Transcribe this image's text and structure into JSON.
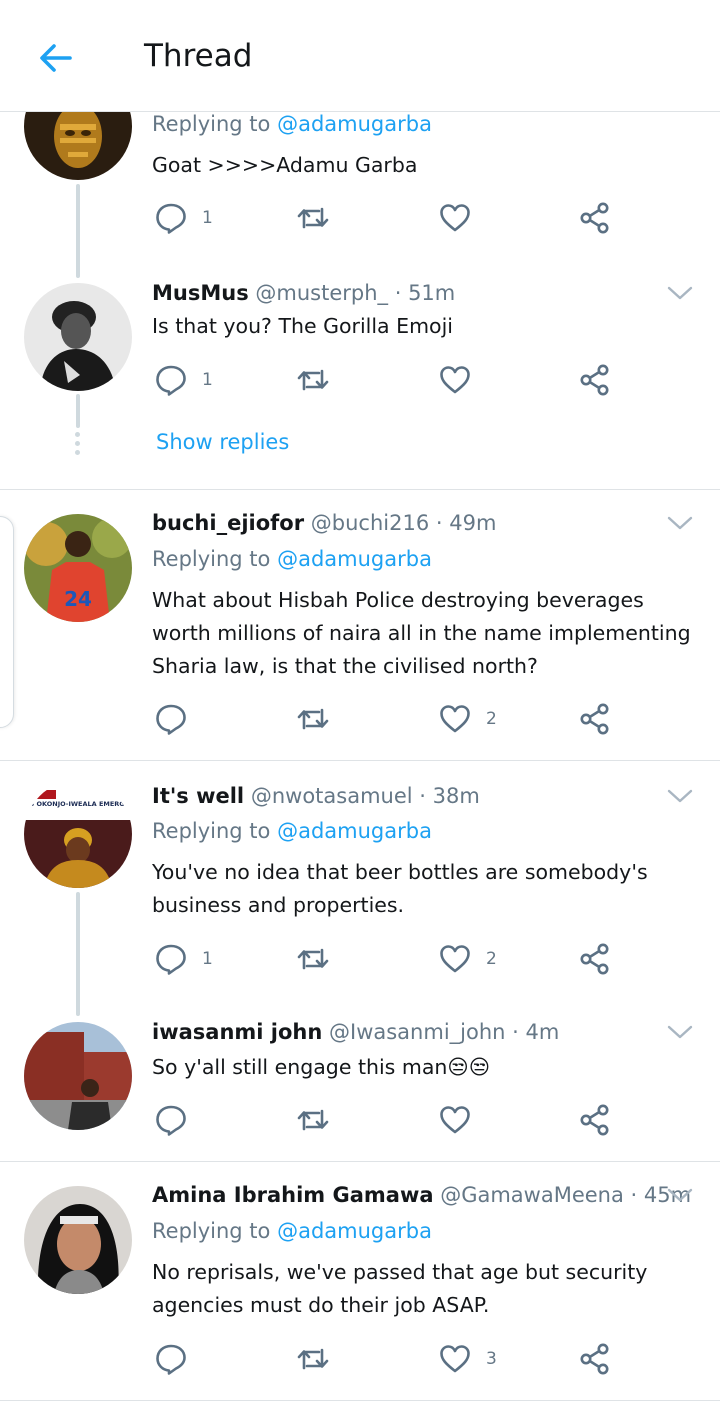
{
  "header": {
    "title": "Thread"
  },
  "tweets": [
    {
      "name": "",
      "handle": "",
      "time": "",
      "replying_label": "Replying to",
      "replying_handle": "@adamugarba",
      "text": "Goat >>>>Adamu Garba",
      "reply_count": "1",
      "retweet_count": "",
      "like_count": ""
    },
    {
      "name": "MusMus",
      "handle": "@musterph_",
      "time": "· 51m",
      "text": "Is that you? The Gorilla Emoji",
      "reply_count": "1",
      "retweet_count": "",
      "like_count": "",
      "show_replies": "Show replies"
    },
    {
      "name": "buchi_ejiofor",
      "handle": "@buchi216",
      "time": "· 49m",
      "replying_label": "Replying to",
      "replying_handle": "@adamugarba",
      "text": "What about Hisbah Police destroying beverages worth millions of naira all in the name implementing Sharia law, is that the civilised north?",
      "reply_count": "",
      "retweet_count": "",
      "like_count": "2"
    },
    {
      "name": "It's well",
      "handle": "@nwotasamuel",
      "time": "· 38m",
      "replying_label": "Replying to",
      "replying_handle": "@adamugarba",
      "text": "You've no idea that beer bottles are somebody's business and properties.",
      "reply_count": "1",
      "retweet_count": "",
      "like_count": "2",
      "avatar_banner": "AKBG NEWS OKONJO-IWEALA EMERGES WTO DG"
    },
    {
      "name": "iwasanmi john",
      "handle": "@Iwasanmi_john",
      "time": "· 4m",
      "text": "So y'all still engage this man😒😒",
      "reply_count": "",
      "retweet_count": "",
      "like_count": ""
    },
    {
      "name": "Amina Ibrahim Gamawa",
      "handle": "@GamawaMeena",
      "time": "· 45m",
      "replying_label": "Replying to",
      "replying_handle": "@adamugarba",
      "text": "No reprisals,  we've passed that age but security agencies must do their job ASAP.",
      "reply_count": "",
      "retweet_count": "",
      "like_count": "3"
    }
  ],
  "colors": {
    "accent": "#1da1f2",
    "muted": "#657786",
    "icon": "#5b7083",
    "line": "#cfd9de"
  },
  "icons": [
    "back-arrow-icon",
    "reply-icon",
    "retweet-icon",
    "like-icon",
    "share-icon",
    "chevron-down-icon"
  ]
}
